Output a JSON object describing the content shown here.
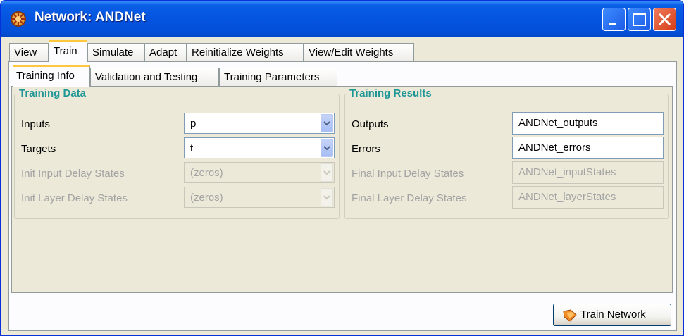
{
  "window": {
    "title": "Network: ANDNet",
    "icons": {
      "app": "network-app-icon",
      "minimize": "minimize-icon",
      "maximize": "maximize-icon",
      "close": "close-icon"
    }
  },
  "main_tabs": [
    {
      "label": "View"
    },
    {
      "label": "Train",
      "selected": true
    },
    {
      "label": "Simulate"
    },
    {
      "label": "Adapt"
    },
    {
      "label": "Reinitialize Weights"
    },
    {
      "label": "View/Edit Weights"
    }
  ],
  "sub_tabs": [
    {
      "label": "Training Info",
      "selected": true
    },
    {
      "label": "Validation and Testing"
    },
    {
      "label": "Training Parameters"
    }
  ],
  "training_data": {
    "title": "Training Data",
    "inputs": {
      "label": "Inputs",
      "value": "p"
    },
    "targets": {
      "label": "Targets",
      "value": "t"
    },
    "init_input_delay": {
      "label": "Init Input Delay States",
      "value": "(zeros)"
    },
    "init_layer_delay": {
      "label": "Init Layer Delay States",
      "value": "(zeros)"
    }
  },
  "training_results": {
    "title": "Training Results",
    "outputs": {
      "label": "Outputs",
      "value": "ANDNet_outputs"
    },
    "errors": {
      "label": "Errors",
      "value": "ANDNet_errors"
    },
    "final_input_delay": {
      "label": "Final Input Delay States",
      "value": "ANDNet_inputStates"
    },
    "final_layer_delay": {
      "label": "Final Layer Delay States",
      "value": "ANDNet_layerStates"
    }
  },
  "train_button": {
    "label": "Train Network",
    "icon": "train-network-icon"
  },
  "colors": {
    "titlebar": "#0454e0",
    "group_title": "#1e9696",
    "tab_highlight": "#ffc83c",
    "window_bg": "#ece9d8"
  }
}
